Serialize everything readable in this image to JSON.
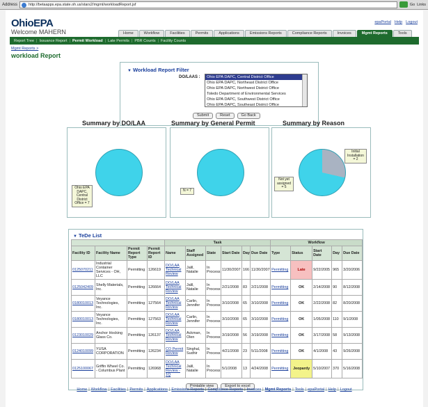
{
  "browser": {
    "address_label": "Address",
    "url": "http://betaapps.epa.state.oh.us/stars2/mgmt/workloadReport.jsf",
    "go_label": "Go",
    "links_label": "Links"
  },
  "header": {
    "logo": "OhioEPA",
    "welcome": "Welcome MAHERN",
    "top_links": [
      "epaPortal",
      "Help",
      "Logout"
    ]
  },
  "tabs": [
    {
      "label": "Home",
      "active": false
    },
    {
      "label": "Workflow",
      "active": false
    },
    {
      "label": "Facilities",
      "active": false
    },
    {
      "label": "Permits",
      "active": false
    },
    {
      "label": "Applications",
      "active": false
    },
    {
      "label": "Emissions Reports",
      "active": false
    },
    {
      "label": "Compliance Reports",
      "active": false
    },
    {
      "label": "Invoices",
      "active": false
    },
    {
      "label": "Mgmt Reports",
      "active": true
    },
    {
      "label": "Tools",
      "active": false
    }
  ],
  "subnav": [
    {
      "label": "Report Tree",
      "current": false
    },
    {
      "label": "Issuance Report",
      "current": false
    },
    {
      "label": "Permit Workload",
      "current": true
    },
    {
      "label": "Late Permits",
      "current": false
    },
    {
      "label": "PBR Counts",
      "current": false
    },
    {
      "label": "Facility Counts",
      "current": false
    }
  ],
  "breadcrumb": "Mgmt Reports  >",
  "page_title": "workload Report",
  "filter": {
    "title": "Workload Report Filter",
    "label": "DO/LAAS :",
    "options": [
      "Ohio EPA DAPC, Central District Office",
      "Ohio EPA DAPC, Northeast District Office",
      "Ohio EPA DAPC, Northwest District Office",
      "Toledo Department of Environmental Services",
      "Ohio EPA DAPC, Southwest District Office",
      "Ohio EPA DAPC, Southeast District Office"
    ],
    "selected_index": 0,
    "buttons": [
      "Submit",
      "Reset",
      "Go Back"
    ]
  },
  "summaries": [
    {
      "title": "Summary by DO/LAA",
      "labels": [
        "Ohio EPA DAPC, Central District Office = 7"
      ]
    },
    {
      "title": "Summary by General Permit",
      "labels": [
        "N = 7"
      ]
    },
    {
      "title": "Summary by Reason",
      "labels": [
        "Not yet assigned = 5",
        "Initial Installation = 2"
      ]
    }
  ],
  "chart_data": [
    {
      "type": "pie",
      "title": "Summary by DO/LAA",
      "categories": [
        "Ohio EPA DAPC, Central District Office"
      ],
      "values": [
        7
      ]
    },
    {
      "type": "pie",
      "title": "Summary by General Permit",
      "categories": [
        "N"
      ],
      "values": [
        7
      ]
    },
    {
      "type": "pie",
      "title": "Summary by Reason",
      "categories": [
        "Not yet assigned",
        "Initial Installation"
      ],
      "values": [
        5,
        2
      ]
    }
  ],
  "colors": {
    "green": "#1e6b2e",
    "pie_primary": "#3fd3ea",
    "pie_secondary": "#a9b3c2"
  },
  "tede": {
    "title": "TeDe List",
    "group_headers": {
      "task": "Task",
      "workflow": "Workflow"
    },
    "columns": [
      "Facility ID",
      "Facility Name",
      "Permit Report Type",
      "Permit Report ID",
      "Name",
      "Staff Assigned",
      "State",
      "Start Date",
      "Day",
      "Due Date",
      "Type",
      "Status",
      "Start Date",
      "Day",
      "Due Date"
    ],
    "rows": [
      [
        "0125070211",
        "Industrial Container Services - OH, LLC",
        "Permitting",
        "126619",
        "DO/LAA Technical Review",
        "Jalil, Natalie",
        "In Process",
        "11/30/2007",
        "166",
        "11/30/2007",
        "Permitting",
        "Late",
        "9/22/2005",
        "965",
        "3/20/2006"
      ],
      [
        "0125042409",
        "Shelly Materials, Inc.",
        "Permitting",
        "126664",
        "DO/LAA Technical Review",
        "Jalil, Natalie",
        "In Process",
        "2/21/2008",
        "83",
        "2/21/2008",
        "Permitting",
        "OK",
        "2/14/2008",
        "90",
        "8/12/2008"
      ],
      [
        "0180010013",
        "Veyance Technologies, Inc.",
        "Permitting",
        "127564",
        "DO/LAA Technical Review",
        "Carlin, Jennifer",
        "In Process",
        "3/10/2008",
        "65",
        "3/10/2008",
        "Permitting",
        "OK",
        "2/22/2008",
        "82",
        "8/20/2008"
      ],
      [
        "0180010013",
        "Veyance Technologies, Inc.",
        "Permitting",
        "127563",
        "DO/LAA Technical Review",
        "Carlin, Jennifer",
        "In Process",
        "3/10/2008",
        "65",
        "3/10/2008",
        "Permitting",
        "OK",
        "1/05/2008",
        "110",
        "9/1/2008"
      ],
      [
        "0123010029",
        "Anchor Hocking Glass Co.",
        "Permitting",
        "126137",
        "DO/LAA Technical Review",
        "Ackman, Olen",
        "In Process",
        "3/19/2008",
        "56",
        "3/19/2008",
        "Permitting",
        "OK",
        "3/17/2008",
        "58",
        "9/13/2008"
      ],
      [
        "0124010099",
        "YUSA CORPORATION",
        "Permitting",
        "126234",
        "CO Permit Review",
        "Singhal, Sudhir",
        "In Process",
        "4/21/2008",
        "23",
        "5/11/2008",
        "Permitting",
        "OK",
        "4/1/2008",
        "43",
        "9/26/2008"
      ],
      [
        "0125100067",
        "Griffin Wheel Co. - Columbus Plant",
        "Permitting",
        "126968",
        "DO/LAA Technical Review - 1Q",
        "Jalil, Natalie",
        "In Process",
        "5/1/2008",
        "13",
        "4/24/2008",
        "Permitting",
        "Jeopardy",
        "5/10/2007",
        "370",
        "5/16/2008"
      ]
    ],
    "buttons": [
      "Printable view",
      "Export to excel"
    ]
  },
  "footer": [
    "Home",
    "Workflow",
    "Facilities",
    "Permits",
    "Applications",
    "Emissions Reports",
    "Compliance Reports",
    "Invoices",
    "Mgmt Reports",
    "Tools",
    "epaPortal",
    "Help",
    "Logout"
  ]
}
